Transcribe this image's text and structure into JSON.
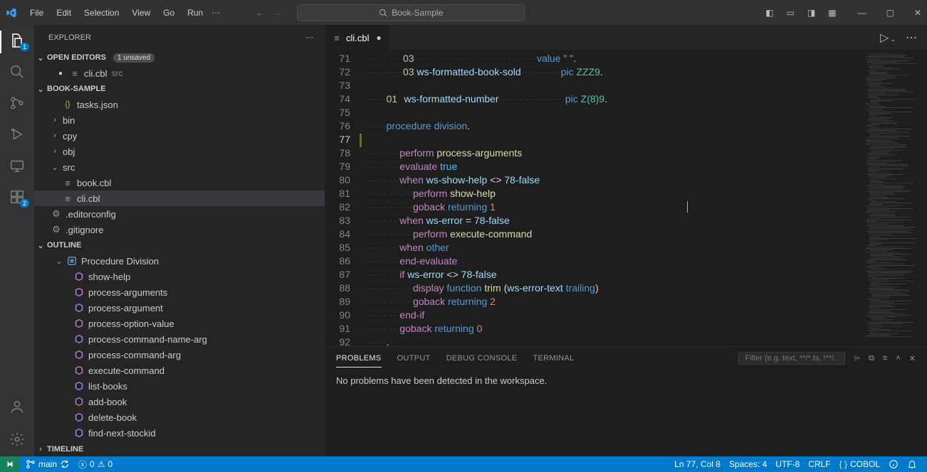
{
  "title": "Book-Sample",
  "menu": [
    "File",
    "Edit",
    "Selection",
    "View",
    "Go",
    "Run"
  ],
  "search_placeholder": "Book-Sample",
  "activity_badges": {
    "explorer": "1",
    "extensions": "2"
  },
  "sidebar": {
    "title": "EXPLORER",
    "open_editors_label": "OPEN EDITORS",
    "unsaved_badge": "1 unsaved",
    "open_editors": [
      {
        "name": "cli.cbl",
        "desc": "src",
        "modified": true
      }
    ],
    "folder_label": "BOOK-SAMPLE",
    "tree": [
      {
        "type": "file",
        "name": "tasks.json",
        "icon": "braces",
        "indent": 2
      },
      {
        "type": "folder",
        "name": "bin",
        "open": false,
        "indent": 1
      },
      {
        "type": "folder",
        "name": "cpy",
        "open": false,
        "indent": 1
      },
      {
        "type": "folder",
        "name": "obj",
        "open": false,
        "indent": 1
      },
      {
        "type": "folder",
        "name": "src",
        "open": true,
        "indent": 1
      },
      {
        "type": "file",
        "name": "book.cbl",
        "icon": "lines",
        "indent": 2
      },
      {
        "type": "file",
        "name": "cli.cbl",
        "icon": "lines",
        "indent": 2,
        "active": true
      },
      {
        "type": "file",
        "name": ".editorconfig",
        "icon": "gear",
        "indent": 1
      },
      {
        "type": "file",
        "name": ".gitignore",
        "icon": "gear",
        "indent": 1
      }
    ],
    "outline_label": "OUTLINE",
    "outline_root": "Procedure Division",
    "outline": [
      "show-help",
      "process-arguments",
      "process-argument",
      "process-option-value",
      "process-command-name-arg",
      "process-command-arg",
      "execute-command",
      "list-books",
      "add-book",
      "delete-book",
      "find-next-stockid"
    ],
    "timeline_label": "TIMELINE"
  },
  "editor": {
    "tab_name": "cli.cbl",
    "first_line_no": 71,
    "lines": [
      [
        [
          "ws",
          "            "
        ],
        [
          "num",
          "03"
        ],
        [
          "ws",
          "                                     "
        ],
        [
          "kw",
          "value"
        ],
        [
          "op",
          " "
        ],
        [
          "str",
          "\" \""
        ],
        [
          "punc",
          "."
        ]
      ],
      [
        [
          "ws",
          "            "
        ],
        [
          "num",
          "03"
        ],
        [
          "op",
          " "
        ],
        [
          "id",
          "ws-formatted-book-sold"
        ],
        [
          "ws",
          "            "
        ],
        [
          "kw",
          "pic"
        ],
        [
          "op",
          " "
        ],
        [
          "pic",
          "ZZZ9"
        ],
        [
          "punc",
          "."
        ]
      ],
      [],
      [
        [
          "ws",
          "       "
        ],
        [
          "num",
          "01"
        ],
        [
          "ws",
          "  "
        ],
        [
          "id",
          "ws-formatted-number"
        ],
        [
          "ws",
          "                    "
        ],
        [
          "kw",
          "pic"
        ],
        [
          "op",
          " "
        ],
        [
          "pic",
          "Z(8)9"
        ],
        [
          "punc",
          "."
        ]
      ],
      [],
      [
        [
          "ws",
          "       "
        ],
        [
          "kw",
          "procedure"
        ],
        [
          "op",
          " "
        ],
        [
          "kw",
          "division"
        ],
        [
          "punc",
          "."
        ]
      ],
      [],
      [
        [
          "ws",
          "           "
        ],
        [
          "kw2",
          "perform"
        ],
        [
          "op",
          " "
        ],
        [
          "fn",
          "process-arguments"
        ]
      ],
      [
        [
          "ws",
          "           "
        ],
        [
          "kw2",
          "evaluate"
        ],
        [
          "op",
          " "
        ],
        [
          "const",
          "true"
        ]
      ],
      [
        [
          "ws",
          "           "
        ],
        [
          "kw2",
          "when"
        ],
        [
          "op",
          " "
        ],
        [
          "id",
          "ws-show-help"
        ],
        [
          "op",
          " <> "
        ],
        [
          "id",
          "78-false"
        ]
      ],
      [
        [
          "ws",
          "               "
        ],
        [
          "kw2",
          "perform"
        ],
        [
          "op",
          " "
        ],
        [
          "fn",
          "show-help"
        ]
      ],
      [
        [
          "ws",
          "               "
        ],
        [
          "kw2",
          "goback"
        ],
        [
          "op",
          " "
        ],
        [
          "kw",
          "returning"
        ],
        [
          "op",
          " "
        ],
        [
          "lit",
          "1"
        ]
      ],
      [
        [
          "ws",
          "           "
        ],
        [
          "kw2",
          "when"
        ],
        [
          "op",
          " "
        ],
        [
          "id",
          "ws-error"
        ],
        [
          "op",
          " = "
        ],
        [
          "id",
          "78-false"
        ]
      ],
      [
        [
          "ws",
          "               "
        ],
        [
          "kw2",
          "perform"
        ],
        [
          "op",
          " "
        ],
        [
          "fn",
          "execute-command"
        ]
      ],
      [
        [
          "ws",
          "           "
        ],
        [
          "kw2",
          "when"
        ],
        [
          "op",
          " "
        ],
        [
          "kw",
          "other"
        ]
      ],
      [
        [
          "ws",
          "           "
        ],
        [
          "kw2",
          "end-evaluate"
        ]
      ],
      [
        [
          "ws",
          "           "
        ],
        [
          "kw2",
          "if"
        ],
        [
          "op",
          " "
        ],
        [
          "id",
          "ws-error"
        ],
        [
          "op",
          " <> "
        ],
        [
          "id",
          "78-false"
        ]
      ],
      [
        [
          "ws",
          "               "
        ],
        [
          "kw2",
          "display"
        ],
        [
          "op",
          " "
        ],
        [
          "kw",
          "function"
        ],
        [
          "op",
          " "
        ],
        [
          "fn",
          "trim"
        ],
        [
          "op",
          " "
        ],
        [
          "punc",
          "("
        ],
        [
          "id",
          "ws-error-text"
        ],
        [
          "op",
          " "
        ],
        [
          "kw",
          "trailing"
        ],
        [
          "punc",
          ")"
        ]
      ],
      [
        [
          "ws",
          "               "
        ],
        [
          "kw2",
          "goback"
        ],
        [
          "op",
          " "
        ],
        [
          "kw",
          "returning"
        ],
        [
          "op",
          " "
        ],
        [
          "lit",
          "2"
        ]
      ],
      [
        [
          "ws",
          "           "
        ],
        [
          "kw2",
          "end-if"
        ]
      ],
      [
        [
          "ws",
          "           "
        ],
        [
          "kw2",
          "goback"
        ],
        [
          "op",
          " "
        ],
        [
          "kw",
          "returning"
        ],
        [
          "op",
          " "
        ],
        [
          "lit",
          "0"
        ]
      ],
      [
        [
          "ws",
          "       "
        ],
        [
          "punc",
          "."
        ]
      ]
    ],
    "current_line_index": 6
  },
  "panel": {
    "tabs": [
      "PROBLEMS",
      "OUTPUT",
      "DEBUG CONSOLE",
      "TERMINAL"
    ],
    "active": 0,
    "filter_placeholder": "Filter (e.g. text, **/*.ts, !**/...",
    "message": "No problems have been detected in the workspace."
  },
  "status": {
    "branch": "main",
    "errors": "0",
    "warnings": "0",
    "cursor": "Ln 77, Col 8",
    "spaces": "Spaces: 4",
    "encoding": "UTF-8",
    "eol": "CRLF",
    "lang": "COBOL"
  }
}
